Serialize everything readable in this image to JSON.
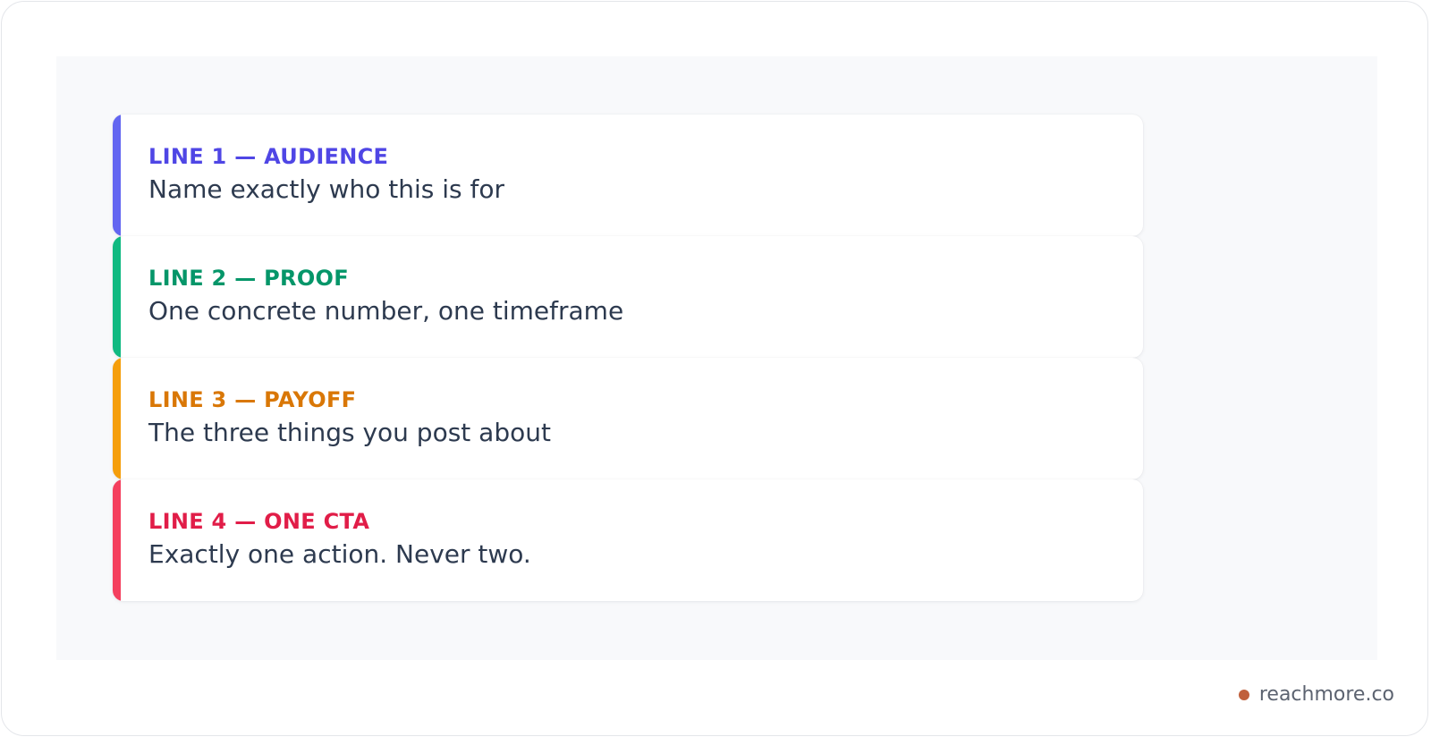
{
  "cards": [
    {
      "label": "LINE 1 — AUDIENCE",
      "text": "Name exactly who this is for",
      "bar_color": "#6366f1",
      "label_color": "#4f46e5"
    },
    {
      "label": "LINE 2 — PROOF",
      "text": "One concrete number, one timeframe",
      "bar_color": "#10b981",
      "label_color": "#059669"
    },
    {
      "label": "LINE 3 — PAYOFF",
      "text": "The three things you post about",
      "bar_color": "#f59e0b",
      "label_color": "#d97706"
    },
    {
      "label": "LINE 4 — ONE CTA",
      "text": "Exactly one action. Never two.",
      "bar_color": "#f43f5e",
      "label_color": "#e11d48"
    }
  ],
  "brand": {
    "name": "reachmore.co",
    "dot_color": "#c0603c"
  }
}
